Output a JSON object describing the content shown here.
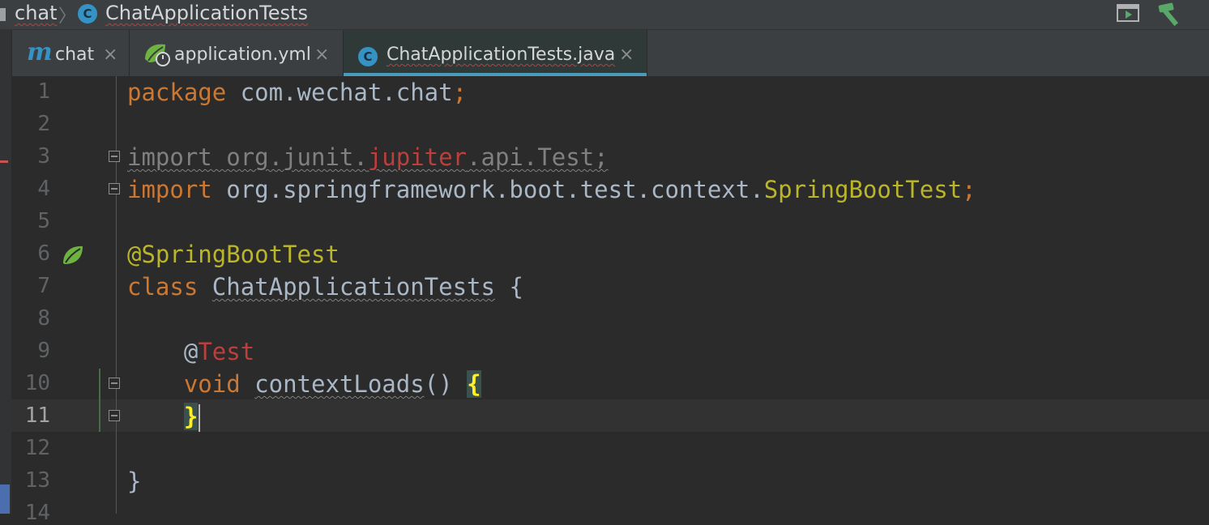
{
  "breadcrumb": {
    "project": "chat",
    "separator": "〉",
    "class_icon_letter": "C",
    "file": "ChatApplicationTests"
  },
  "toolbar": {
    "run_icon": "run-configuration-icon",
    "build_icon": "hammer-icon"
  },
  "tabs": [
    {
      "label": "chat",
      "icon": "maven-m-icon",
      "close": "×",
      "active": false
    },
    {
      "label": "application.yml",
      "icon": "spring-boot-icon",
      "close": "×",
      "active": false
    },
    {
      "label": "ChatApplicationTests.java",
      "icon_letter": "C",
      "close": "×",
      "active": true
    }
  ],
  "editor": {
    "line_numbers": [
      "1",
      "2",
      "3",
      "4",
      "5",
      "6",
      "7",
      "8",
      "9",
      "10",
      "11",
      "12",
      "13",
      "14"
    ],
    "current_line": "11",
    "lines": {
      "l1_kw": "package",
      "l1_rest": " com.wechat.chat",
      "l1_semi": ";",
      "l3_a": "import org.junit.",
      "l3_b": "jupiter",
      "l3_c": ".api.Test;",
      "l4_kw": "import",
      "l4_pkg": " org.springframework.boot.test.context.",
      "l4_cls": "SpringBootTest",
      "l4_semi": ";",
      "l6_ann": "@SpringBootTest",
      "l7_kw": "class",
      "l7_sp": " ",
      "l7_cls": "ChatApplicationTests",
      "l7_rest": " {",
      "l9_at": "@",
      "l9_test": "Test",
      "l10_kw": "void",
      "l10_sp": " ",
      "l10_m": "contextLoads",
      "l10_rest": "() ",
      "l10_brace": "{",
      "l11_brace": "}",
      "l13": "}"
    }
  },
  "colors": {
    "keyword": "#cc7832",
    "annotation": "#bbb529",
    "error": "#bc3f3c",
    "text": "#a9b7c6",
    "background": "#2b2b2b"
  }
}
